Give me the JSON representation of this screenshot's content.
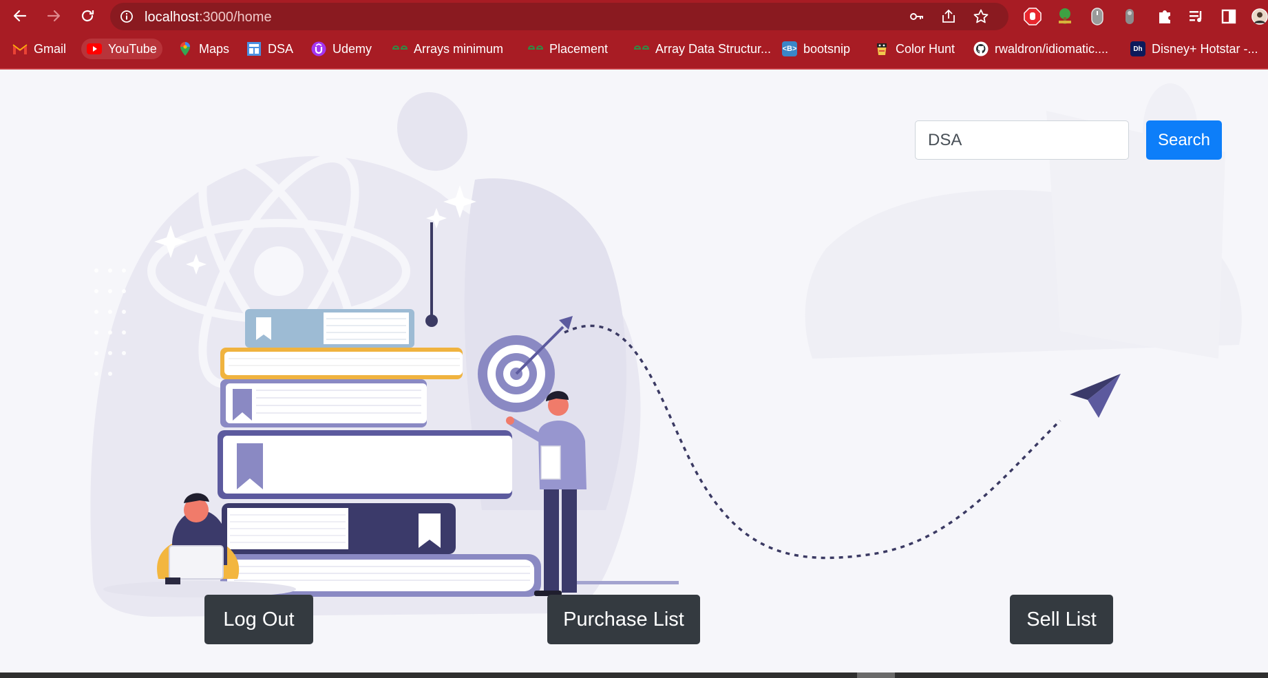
{
  "browser": {
    "url_host": "localhost",
    "url_path": ":3000/home",
    "bookmarks": [
      {
        "label": "Gmail",
        "icon": "gmail-icon"
      },
      {
        "label": "YouTube",
        "icon": "youtube-icon"
      },
      {
        "label": "Maps",
        "icon": "maps-icon"
      },
      {
        "label": "DSA",
        "icon": "dsa-icon"
      },
      {
        "label": "Udemy",
        "icon": "udemy-icon"
      },
      {
        "label": "Arrays minimum",
        "icon": "geeksforgeeks-icon"
      },
      {
        "label": "Placement",
        "icon": "geeksforgeeks-icon"
      },
      {
        "label": "Array Data Structur...",
        "icon": "geeksforgeeks-icon"
      },
      {
        "label": "bootsnip",
        "icon": "bootsnipp-icon"
      },
      {
        "label": "Color Hunt",
        "icon": "colorhunt-icon"
      },
      {
        "label": "rwaldron/idiomatic....",
        "icon": "github-icon"
      },
      {
        "label": "Disney+ Hotstar -...",
        "icon": "hotstar-icon"
      }
    ],
    "colors": {
      "frame": "#a81c24",
      "omnibox": "#8a1a20"
    }
  },
  "search": {
    "value": "DSA",
    "button": "Search"
  },
  "actions": {
    "logout": "Log Out",
    "purchase": "Purchase List",
    "sell": "Sell List"
  },
  "colors": {
    "primary": "#0d7ef9",
    "dark": "#343a40",
    "illustration": "#5c5a9e"
  }
}
